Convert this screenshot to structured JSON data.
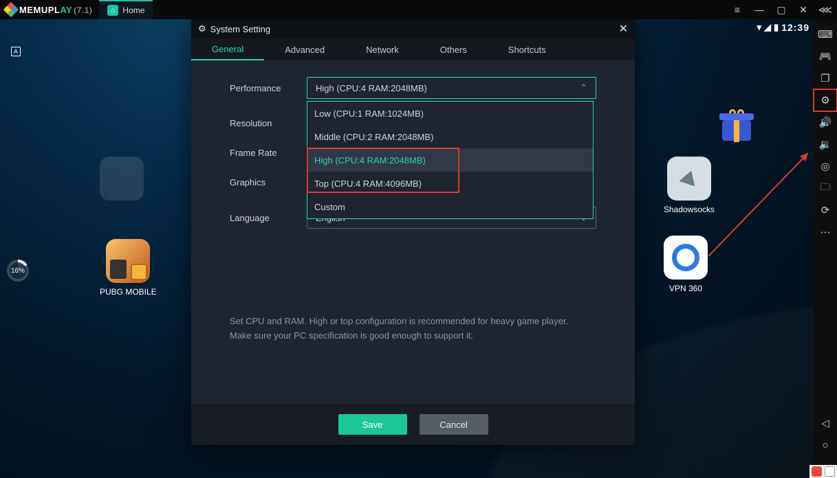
{
  "titlebar": {
    "brand_a": "MEMU ",
    "brand_b": "PL",
    "brand_c": "AY",
    "version": "(7.1)",
    "tab_home": "Home"
  },
  "android": {
    "clock": "12:39",
    "progress": "16%",
    "ad_badge": "A"
  },
  "desktop": {
    "pubg": "PUBG MOBILE",
    "shadowsocks": "Shadowsocks",
    "vpn360": "VPN 360"
  },
  "settings": {
    "title": "System Setting",
    "tabs": {
      "general": "General",
      "advanced": "Advanced",
      "network": "Network",
      "others": "Others",
      "shortcuts": "Shortcuts"
    },
    "labels": {
      "perf": "Performance",
      "res": "Resolution",
      "fps": "Frame Rate",
      "gfx": "Graphics",
      "lang": "Language"
    },
    "perf_selected": "High (CPU:4 RAM:2048MB)",
    "perf_options": {
      "low": "Low (CPU:1 RAM:1024MB)",
      "mid": "Middle (CPU:2 RAM:2048MB)",
      "high": "High (CPU:4 RAM:2048MB)",
      "top": "Top (CPU:4 RAM:4096MB)",
      "custom": "Custom"
    },
    "lang_selected": "English",
    "hint": "Set CPU and RAM. High or top configuration is recommended for heavy game player. Make sure your PC specification is good enough to support it.",
    "save": "Save",
    "cancel": "Cancel"
  }
}
